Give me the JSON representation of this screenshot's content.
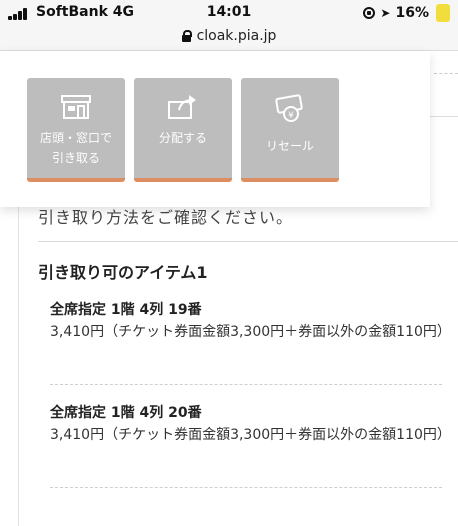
{
  "status": {
    "carrier": "SoftBank 4G",
    "time": "14:01",
    "battery": "16%"
  },
  "browser": {
    "url": "cloak.pia.jp"
  },
  "actions": [
    {
      "line1": "店頭・窓口で",
      "line2": "引き取る",
      "icon": "storefront-icon"
    },
    {
      "line1": "分配する",
      "icon": "share-forward-icon"
    },
    {
      "line1": "リセール",
      "icon": "resale-ticket-icon"
    }
  ],
  "content": {
    "intro": "引き取り方法をご確認ください。",
    "heading": "引き取り可のアイテム1",
    "items": [
      {
        "title": "全席指定 1階 4列 19番",
        "price": "3,410円（チケット券面金額3,300円＋券面以外の金額110円）"
      },
      {
        "title": "全席指定 1階 4列 20番",
        "price": "3,410円（チケット券面金額3,300円＋券面以外の金額110円）"
      }
    ]
  },
  "colors": {
    "tile_bg": "#bdbdbd",
    "tile_accent": "#dd8d62",
    "battery": "#f1dd3c"
  }
}
